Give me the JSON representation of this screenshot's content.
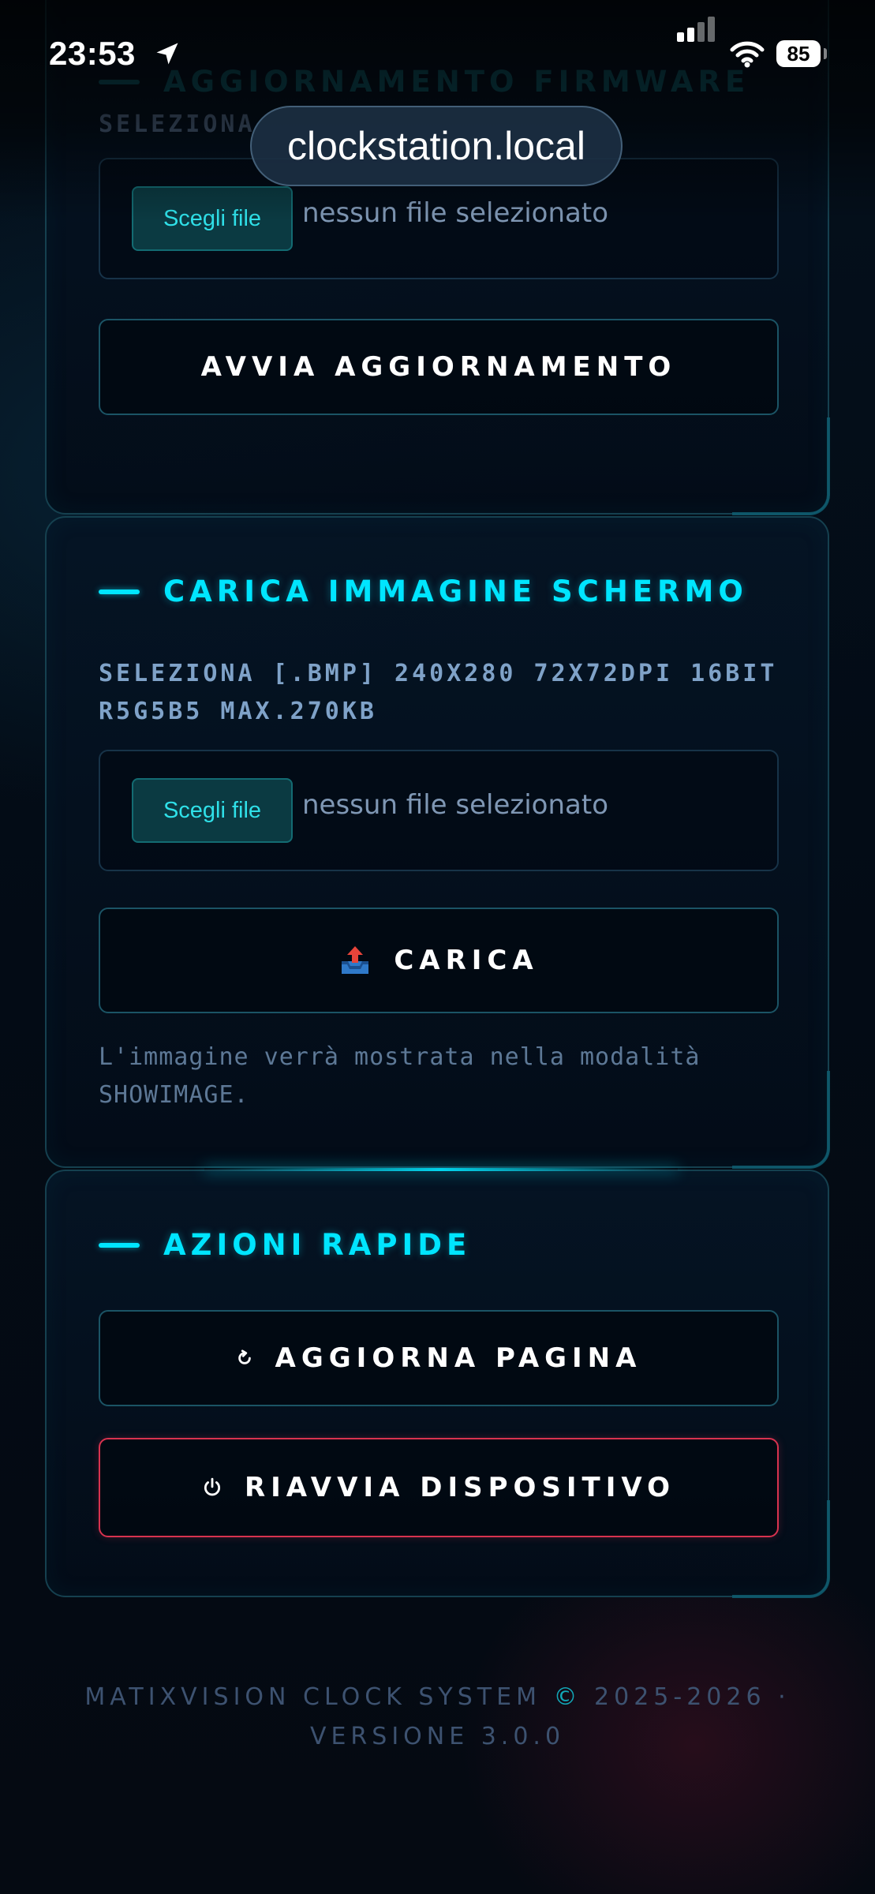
{
  "status_bar": {
    "time": "23:53",
    "battery": "85"
  },
  "browser": {
    "url": "clockstation.local"
  },
  "firmware_card": {
    "title": "AGGIORNAMENTO FIRMWARE",
    "label": "SELEZIONA",
    "file_button": "Scegli file",
    "file_status": "nessun file selezionato",
    "action_button": "AVVIA AGGIORNAMENTO"
  },
  "image_card": {
    "title": "CARICA IMMAGINE SCHERMO",
    "label": "SELEZIONA [.BMP] 240X280 72X72DPI 16BIT R5G5B5 MAX.270KB",
    "file_button": "Scegli file",
    "file_status": "nessun file selezionato",
    "action_button": "CARICA",
    "action_icon": "inbox-tray-upload-icon",
    "note": "L'immagine verrà mostrata nella modalità SHOWIMAGE."
  },
  "quick_actions_card": {
    "title": "AZIONI RAPIDE",
    "refresh_button": "AGGIORNA PAGINA",
    "refresh_icon": "refresh-icon",
    "reboot_button": "RIAVVIA DISPOSITIVO",
    "reboot_icon": "power-icon"
  },
  "footer": {
    "line1_text": "MATIXVISION CLOCK SYSTEM",
    "copyright_symbol": "©",
    "years": "2025-2026 ·",
    "line2": "VERSIONE 3.0.0"
  },
  "colors": {
    "accent": "#00e5ff",
    "danger": "#d8324f",
    "background": "#030b15"
  }
}
